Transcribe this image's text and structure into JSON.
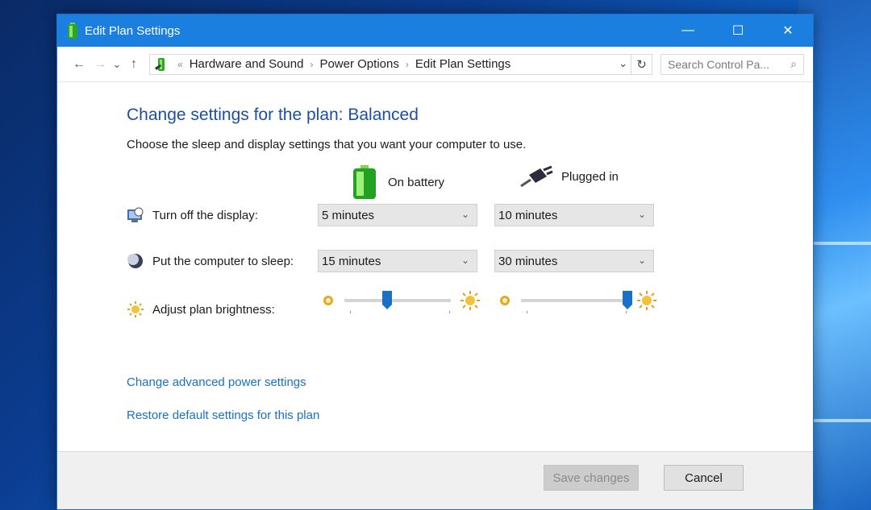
{
  "window": {
    "title": "Edit Plan Settings",
    "controls": {
      "minimize": "—",
      "maximize": "☐",
      "close": "✕"
    }
  },
  "address_bar": {
    "back": "←",
    "forward": "→",
    "recent": "⌄",
    "up": "↑",
    "overflow": "«",
    "separator": "›",
    "breadcrumbs": [
      "Hardware and Sound",
      "Power Options",
      "Edit Plan Settings"
    ],
    "dropdown": "⌄",
    "refresh": "↻",
    "search_placeholder": "Search Control Pa...",
    "search_icon": "⌕"
  },
  "content": {
    "heading": "Change settings for the plan: Balanced",
    "subheading": "Choose the sleep and display settings that you want your computer to use.",
    "columns": {
      "battery": "On battery",
      "plugged": "Plugged in"
    },
    "rows": {
      "display": {
        "label": "Turn off the display:",
        "battery": "5 minutes",
        "plugged": "10 minutes"
      },
      "sleep": {
        "label": "Put the computer to sleep:",
        "battery": "15 minutes",
        "plugged": "30 minutes"
      },
      "brightness": {
        "label": "Adjust plan brightness:",
        "battery_level": 0.4,
        "plugged_level": 1.0
      }
    },
    "select_chevron": "⌄",
    "links": {
      "advanced": "Change advanced power settings",
      "restore": "Restore default settings for this plan"
    }
  },
  "footer": {
    "save": "Save changes",
    "cancel": "Cancel"
  },
  "colors": {
    "titlebar": "#1b7fe0",
    "heading": "#1d4fa0",
    "link": "#1a6fc7",
    "slider_thumb": "#1a6fc7"
  }
}
